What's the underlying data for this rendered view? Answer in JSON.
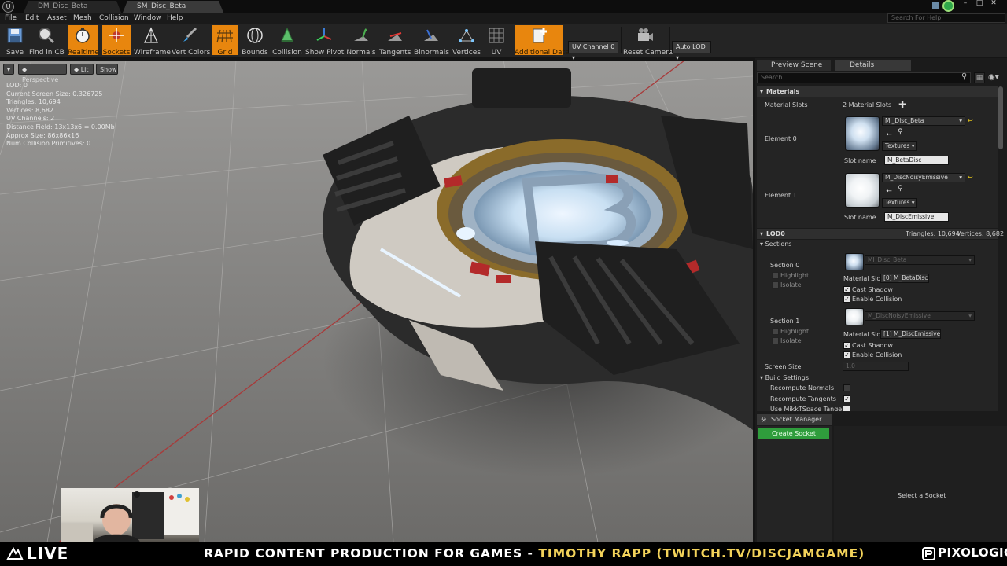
{
  "window": {
    "tabs": [
      {
        "label": "DM_Disc_Beta"
      },
      {
        "label": "SM_Disc_Beta"
      }
    ],
    "help_search_placeholder": "Search For Help"
  },
  "menu": [
    "File",
    "Edit",
    "Asset",
    "Mesh",
    "Collision",
    "Window",
    "Help"
  ],
  "toolbar": {
    "buttons": [
      {
        "label": "Save",
        "icon": "save-icon",
        "active": false
      },
      {
        "label": "Find in CB",
        "icon": "magnifier-icon",
        "active": false
      },
      {
        "label": "Realtime",
        "icon": "stopwatch-icon",
        "active": true
      },
      {
        "label": "Sockets",
        "icon": "socket-icon",
        "active": true
      },
      {
        "label": "Wireframe",
        "icon": "wireframe-icon",
        "active": false
      },
      {
        "label": "Vert Colors",
        "icon": "paintbrush-icon",
        "active": false
      },
      {
        "label": "Grid",
        "icon": "grid-icon",
        "active": true
      },
      {
        "label": "Bounds",
        "icon": "bounds-icon",
        "active": false
      },
      {
        "label": "Collision",
        "icon": "collision-icon",
        "active": false
      },
      {
        "label": "Show Pivot",
        "icon": "pivot-icon",
        "active": false
      },
      {
        "label": "Normals",
        "icon": "normals-icon",
        "active": false
      },
      {
        "label": "Tangents",
        "icon": "tangents-icon",
        "active": false
      },
      {
        "label": "Binormals",
        "icon": "binormals-icon",
        "active": false
      },
      {
        "label": "Vertices",
        "icon": "vertices-icon",
        "active": false
      },
      {
        "label": "UV",
        "icon": "uv-icon",
        "active": false
      },
      {
        "label": "Additional Data",
        "icon": "additional-data-icon",
        "active": true
      }
    ],
    "uv_channel": "UV Channel 0",
    "reset_camera": "Reset Camera",
    "auto_lod": "Auto LOD",
    "accent_color": "#e8860e"
  },
  "viewport": {
    "buttons": {
      "perspective": "Perspective",
      "lit": "Lit",
      "show": "Show"
    },
    "stats": [
      "LOD:  0",
      "Current Screen Size:  0.326725",
      "Triangles:  10,694",
      "Vertices:  8,682",
      "UV Channels:  2",
      "Distance Field:  13x13x6 = 0.00Mb",
      "Approx Size: 86x86x16",
      "Num Collision Primitives:  0"
    ]
  },
  "panels": {
    "tabs": [
      {
        "label": "Preview Scene Setti"
      },
      {
        "label": "Details"
      }
    ],
    "search_placeholder": "Search",
    "materials": {
      "header": "Materials",
      "slots_label": "Material Slots",
      "slots_count": "2 Material Slots",
      "elements": [
        {
          "label": "Element 0",
          "material": "MI_Disc_Beta",
          "textures": "Textures",
          "slot_name_label": "Slot name",
          "slot_name": "M_BetaDisc"
        },
        {
          "label": "Element 1",
          "material": "M_DiscNoisyEmissive",
          "textures": "Textures",
          "slot_name_label": "Slot name",
          "slot_name": "M_DiscEmissive"
        }
      ]
    },
    "lod0": {
      "header": "LOD0",
      "triangles": "Triangles: 10,694",
      "vertices": "Vertices: 8,682",
      "sections_header": "Sections",
      "sections": [
        {
          "label": "Section 0",
          "material": "MI_Disc_Beta",
          "highlight": "Highlight",
          "isolate": "Isolate",
          "material_slot_label": "Material Slot",
          "material_slot": "[0] M_BetaDisc",
          "cast_shadow": "Cast Shadow",
          "enable_collision": "Enable Collision"
        },
        {
          "label": "Section 1",
          "material": "M_DiscNoisyEmissive",
          "highlight": "Highlight",
          "isolate": "Isolate",
          "material_slot_label": "Material Slot",
          "material_slot": "[1] M_DiscEmissive",
          "cast_shadow": "Cast Shadow",
          "enable_collision": "Enable Collision"
        }
      ],
      "screen_size_label": "Screen Size",
      "screen_size": "1.0",
      "build_settings": "Build Settings",
      "recompute_normals": "Recompute Normals",
      "recompute_tangents": "Recompute Tangents",
      "use_mikk": "Use MikkTSpace Tangent"
    },
    "socket_manager": {
      "tab": "Socket Manager",
      "create": "Create Socket",
      "empty": "Select a Socket"
    }
  },
  "stream": {
    "live": "LIVE",
    "banner_a": "RAPID CONTENT PRODUCTION FOR GAMES - ",
    "banner_b": "TIMOTHY RAPP (TWITCH.TV/DISCJAMGAME)",
    "brand": "PIXOLOGIC"
  }
}
